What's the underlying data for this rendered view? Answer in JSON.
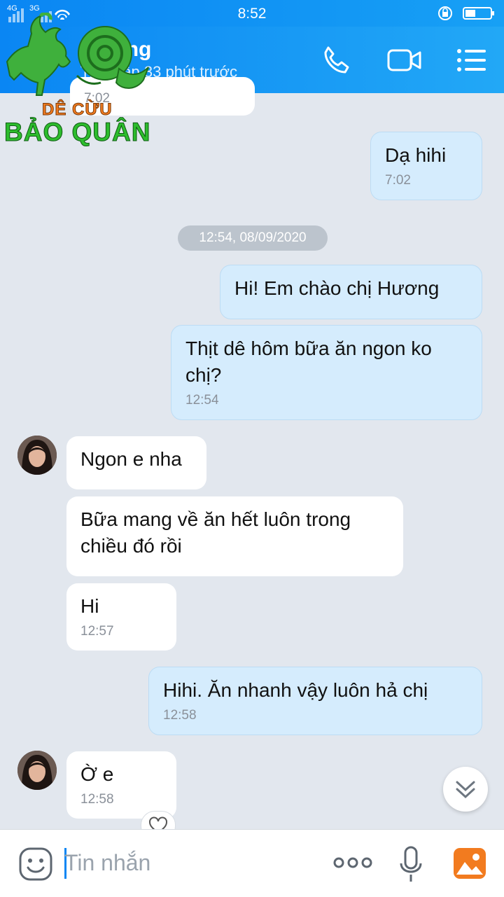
{
  "status_bar": {
    "time": "8:52",
    "network_1": "4G",
    "network_2": "3G"
  },
  "header": {
    "contact_name": "Hương",
    "last_seen": "Truy cập 33 phút trước",
    "icons": [
      "phone-icon",
      "video-call-icon",
      "menu-list-icon"
    ]
  },
  "logo": {
    "line1": "DÊ CỪU",
    "line2": "BẢO QUÂN"
  },
  "chat": {
    "partial_time": "7:02",
    "messages": [
      {
        "from": "me",
        "text": "Dạ hihi",
        "time": "7:02"
      },
      {
        "from": "me",
        "text": "Hi!  Em chào chị Hương",
        "time": ""
      },
      {
        "from": "me",
        "text": "Thịt dê hôm bữa ăn ngon ko chị?",
        "time": "12:54"
      },
      {
        "from": "them",
        "text": "Ngon e nha",
        "time": ""
      },
      {
        "from": "them",
        "text": "Bữa mang về ăn hết luôn trong chiều đó rồi",
        "time": ""
      },
      {
        "from": "them",
        "text": "Hi",
        "time": "12:57"
      },
      {
        "from": "me",
        "text": "Hihi.  Ăn nhanh vậy luôn hả chị",
        "time": "12:58"
      },
      {
        "from": "them",
        "text": "Ờ e",
        "time": "12:58"
      }
    ],
    "date_separator": "12:54, 08/09/2020"
  },
  "input_bar": {
    "placeholder": "Tin nhắn",
    "icons": [
      "emoji-icon",
      "more-dots-icon",
      "microphone-icon",
      "image-gallery-icon"
    ]
  },
  "colors": {
    "header_blue": "#0a86f3",
    "outgoing_bubble": "#d5ecfd",
    "incoming_bubble": "#ffffff",
    "chat_background": "#e2e7ee"
  }
}
